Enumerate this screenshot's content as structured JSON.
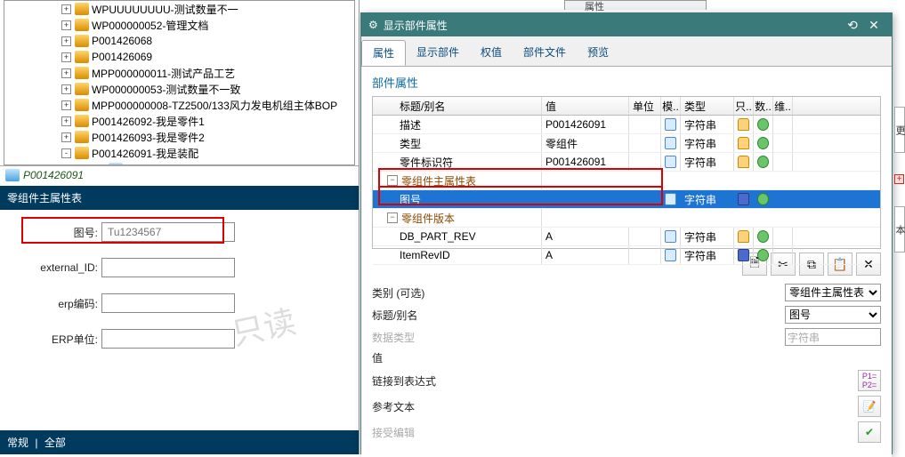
{
  "tree": {
    "items": [
      {
        "depth": 0,
        "exp": "+",
        "label": "WPUUUUUUUU-测试数量不一"
      },
      {
        "depth": 0,
        "exp": "+",
        "label": "WP000000052-管理文档"
      },
      {
        "depth": 0,
        "exp": "+",
        "label": "P001426068"
      },
      {
        "depth": 0,
        "exp": "+",
        "label": "P001426069"
      },
      {
        "depth": 0,
        "exp": "+",
        "label": "MPP000000011-测试产品工艺"
      },
      {
        "depth": 0,
        "exp": "+",
        "label": "WP000000053-测试数量不一致"
      },
      {
        "depth": 0,
        "exp": "+",
        "label": "MPP000000008-TZ2500/133风力发电机组主体BOP"
      },
      {
        "depth": 0,
        "exp": "+",
        "label": "P001426092-我是零件1"
      },
      {
        "depth": 0,
        "exp": "+",
        "label": "P001426093-我是零件2"
      },
      {
        "depth": 0,
        "exp": "-",
        "label": "P001426091-我是装配"
      },
      {
        "depth": 1,
        "exp": " ",
        "label": "P001426091",
        "part": true
      }
    ]
  },
  "selected_bar": "P001426091",
  "section_header": "零组件主属性表",
  "form": {
    "tuhao": {
      "label": "图号:",
      "placeholder": "Tu1234567"
    },
    "external_id": {
      "label": "external_ID:"
    },
    "erp_code": {
      "label": "erp编码:"
    },
    "erp_unit": {
      "label": "ERP单位:"
    }
  },
  "watermark": "只读",
  "bottom_tabs": {
    "a": "常规",
    "sep": "|",
    "b": "全部"
  },
  "dialog": {
    "title": "显示部件属性",
    "tabs": [
      "属性",
      "显示部件",
      "权值",
      "部件文件",
      "预览"
    ],
    "subheader": "部件属性",
    "grid": {
      "head": [
        "标题/别名",
        "值",
        "单位",
        "模..",
        "类型",
        "只..",
        "数..",
        "维.."
      ],
      "rows": [
        {
          "kind": "row",
          "name": "描述",
          "val": "P001426091",
          "type": "字符串",
          "mo": "page",
          "ro": "lock",
          "num": "refresh"
        },
        {
          "kind": "row",
          "name": "类型",
          "val": "零组件",
          "type": "字符串",
          "mo": "page",
          "ro": "lock",
          "num": "refresh"
        },
        {
          "kind": "row",
          "name": "零件标识符",
          "val": "P001426091",
          "type": "字符串",
          "mo": "page",
          "ro": "lock",
          "num": "refresh"
        },
        {
          "kind": "group",
          "name": "零组件主属性表"
        },
        {
          "kind": "row",
          "sel": true,
          "name": "图号",
          "val": "",
          "type": "字符串",
          "mo": "page",
          "ro": "disk",
          "num": "refresh"
        },
        {
          "kind": "group",
          "name": "零组件版本"
        },
        {
          "kind": "row",
          "name": "DB_PART_REV",
          "val": "A",
          "type": "字符串",
          "mo": "page",
          "ro": "lock",
          "num": "refresh"
        },
        {
          "kind": "row",
          "name": "ItemRevID",
          "val": "A",
          "type": "字符串",
          "mo": "page",
          "ro": "disk",
          "num": "refresh"
        }
      ]
    },
    "fields": {
      "category": {
        "label": "类别 (可选)",
        "value": "零组件主属性表"
      },
      "title_alias": {
        "label": "标题/别名",
        "value": "图号"
      },
      "data_type": {
        "label": "数据类型",
        "value": "字符串"
      },
      "value": {
        "label": "值"
      },
      "link_expr": {
        "label": "链接到表达式"
      },
      "ref_text": {
        "label": "参考文本"
      },
      "accept_edit": {
        "label": "接受编辑"
      }
    }
  },
  "side": {
    "a": "更",
    "b": "本"
  }
}
